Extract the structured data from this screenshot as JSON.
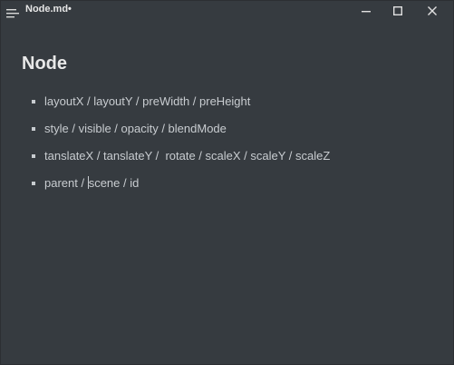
{
  "window": {
    "title": "Node.md•"
  },
  "document": {
    "heading": "Node",
    "items": [
      {
        "text": "layoutX / layoutY / preWidth / preHeight"
      },
      {
        "text": "style / visible / opacity / blendMode"
      },
      {
        "text": "tanslateX / tanslateY /  rotate / scaleX / scaleY / scaleZ"
      },
      {
        "text_before_cursor": "parent / ",
        "text_after_cursor": "scene / id"
      }
    ]
  },
  "icons": {
    "menu": "hamburger-menu-icon",
    "minimize": "minimize-icon",
    "maximize": "maximize-icon",
    "close": "close-icon"
  },
  "colors": {
    "background": "#363b40",
    "text": "#c8ccd0",
    "heading": "#e8e8e8"
  }
}
